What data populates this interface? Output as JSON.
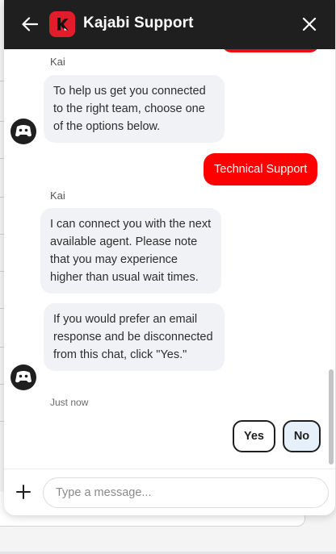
{
  "header": {
    "title": "Kajabi Support",
    "logo_letter": "k",
    "brand_color": "#e11d2b",
    "back_icon": "arrow-left-icon",
    "close_icon": "close-icon"
  },
  "messages": {
    "sender_1": "Kai",
    "bubble_1": "To help us get you connected to the right team, choose one of the options below.",
    "user_choice": "Technical Support",
    "sender_2": "Kai",
    "bubble_2": "I can connect you with the next available agent. Please note that you may experience higher than usual wait times.",
    "bubble_3": "If you would prefer an email response and be disconnected from this chat, click \"Yes.\"",
    "timestamp": "Just now",
    "accent_color": "#ff0000"
  },
  "quick_replies": {
    "yes_label": "Yes",
    "no_label": "No"
  },
  "composer": {
    "placeholder": "Type a message...",
    "add_icon": "plus-icon"
  }
}
